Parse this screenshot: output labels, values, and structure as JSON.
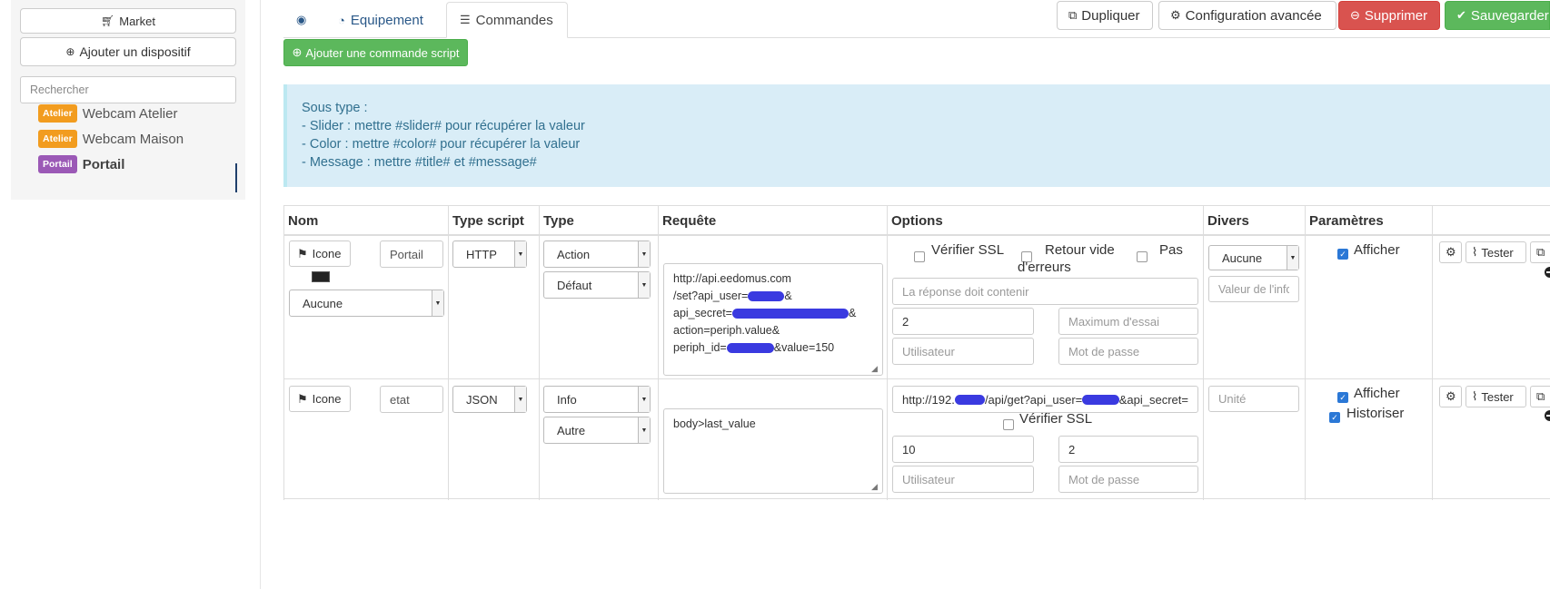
{
  "sidebar": {
    "market_label": "Market",
    "add_device_label": "Ajouter un dispositif",
    "search_placeholder": "Rechercher",
    "items": [
      {
        "badge": "Atelier",
        "label": "Webcam Atelier",
        "badge_color": "#f29c1f"
      },
      {
        "badge": "Atelier",
        "label": "Webcam Maison",
        "badge_color": "#f29c1f"
      },
      {
        "badge": "Portail",
        "label": "Portail",
        "badge_color": "#9b59b6",
        "active": true
      }
    ]
  },
  "tabs": {
    "back_icon": "circle-arrow-left-icon",
    "equipment_label": "Equipement",
    "commands_label": "Commandes"
  },
  "actions": {
    "duplicate_label": "Dupliquer",
    "advanced_label": "Configuration avancée",
    "delete_label": "Supprimer",
    "save_label": "Sauvegarder"
  },
  "add_command_label": "Ajouter une commande script",
  "info": {
    "lines": [
      "Sous type :",
      "- Slider : mettre #slider# pour récupérer la valeur",
      "- Color : mettre #color# pour récupérer la valeur",
      "- Message : mettre #title# et #message#"
    ]
  },
  "table": {
    "headers": [
      "Nom",
      "Type script",
      "Type",
      "Requête",
      "Options",
      "Divers",
      "Paramètres"
    ],
    "rows": [
      {
        "icon_label": "Icone",
        "name": "Portail",
        "link": "Aucune",
        "script_type": "HTTP",
        "type": "Action",
        "subtype": "Défaut",
        "request_lines": [
          "http://api.eedomus.com",
          "/set?api_user=",
          "api_secret=",
          "action=periph.value&",
          "periph_id=",
          "&value=150"
        ],
        "verify_ssl_label": "Vérifier SSL",
        "empty_return_label": "Retour vide",
        "no_errors_label": "Pas",
        "no_errors_label_2": "d'erreurs",
        "response_placeholder": "La réponse doit contenir",
        "retries_value": "2",
        "max_retries_placeholder": "Maximum d'essai",
        "user_placeholder": "Utilisateur",
        "password_placeholder": "Mot de passe",
        "divers_select": "Aucune",
        "divers_placeholder": "Valeur de l'info",
        "show_label": "Afficher",
        "test_label": "Tester"
      },
      {
        "icon_label": "Icone",
        "name": "etat",
        "script_type": "JSON",
        "type": "Info",
        "subtype": "Autre",
        "request": "body>last_value",
        "url_prefix": "http://192.",
        "url_mid": "/api/get?api_user=",
        "url_suffix": "&api_secret=",
        "verify_ssl_label": "Vérifier SSL",
        "value_a": "10",
        "value_b": "2",
        "user_placeholder": "Utilisateur",
        "password_placeholder": "Mot de passe",
        "unit_placeholder": "Unité",
        "show_label": "Afficher",
        "historize_label": "Historiser",
        "test_label": "Tester"
      }
    ]
  },
  "colors": {
    "danger": "#d9534f",
    "success": "#5cb85c",
    "info_bg": "#d9edf7",
    "info_text": "#31708f",
    "link": "#2a5888",
    "checkbox": "#2b78d6"
  }
}
